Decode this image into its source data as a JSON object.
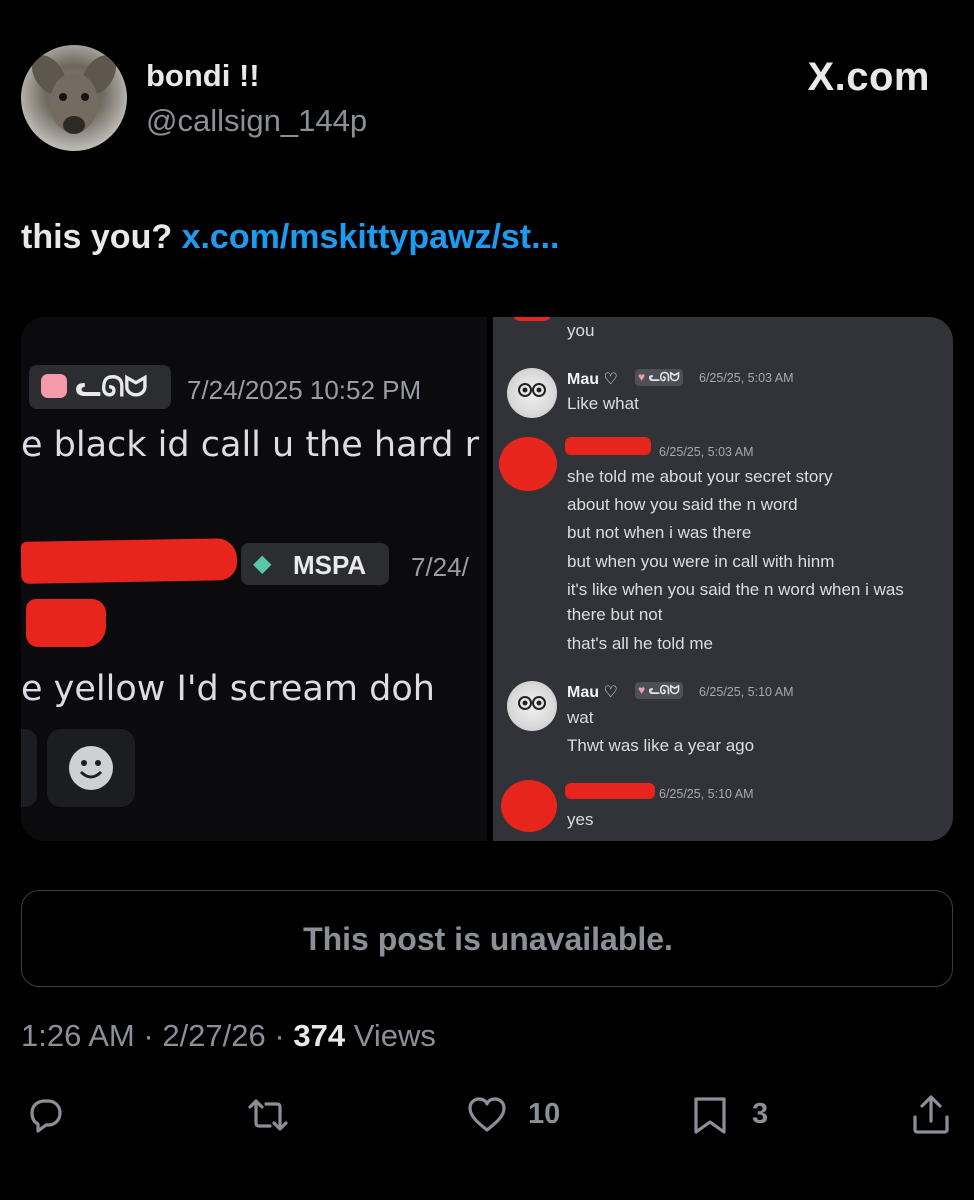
{
  "header": {
    "display_name": "bondi !!",
    "handle": "@callsign_144p",
    "site": "X.com"
  },
  "tweet": {
    "text": "this you?",
    "link": "x.com/mskittypawz/st..."
  },
  "media": {
    "left": {
      "tag1": "ᓚᘏᗢ",
      "time1": "7/24/2025 10:52 PM",
      "line1": "e black id call u the hard r",
      "tag2": "MSPA",
      "time2": "7/24/",
      "line2": "e yellow I'd scream doh"
    },
    "right": {
      "top_msg": "you",
      "msgs": [
        {
          "name": "Mau ♡",
          "tag": "ᓚᘏᗢ",
          "time": "6/25/25, 5:03 AM",
          "lines": [
            "Like what"
          ]
        },
        {
          "name": "",
          "tag": "",
          "time": "6/25/25, 5:03 AM",
          "lines": [
            "she told me about your secret story",
            "about how you said the n word",
            "but not when i was there",
            "but when you were in call with hinm",
            "it's like when you said the n word when i was",
            "there but not",
            "that's all he told me"
          ]
        },
        {
          "name": "Mau ♡",
          "tag": "ᓚᘏᗢ",
          "time": "6/25/25, 5:10 AM",
          "lines": [
            "wat",
            "Thwt was like a year ago"
          ]
        },
        {
          "name": "",
          "tag": "",
          "time": "6/25/25, 5:10 AM",
          "lines": [
            "yes"
          ]
        }
      ]
    }
  },
  "quote": {
    "unavailable": "This post is unavailable."
  },
  "meta": {
    "time": "1:26 AM",
    "date": "2/27/26",
    "views": "374",
    "views_label": "Views",
    "sep": "·"
  },
  "actions": {
    "likes": "10",
    "bookmarks": "3"
  },
  "colors": {
    "link": "#1d9bf0",
    "redaction": "#e8251d",
    "discord_bg": "#313338"
  }
}
